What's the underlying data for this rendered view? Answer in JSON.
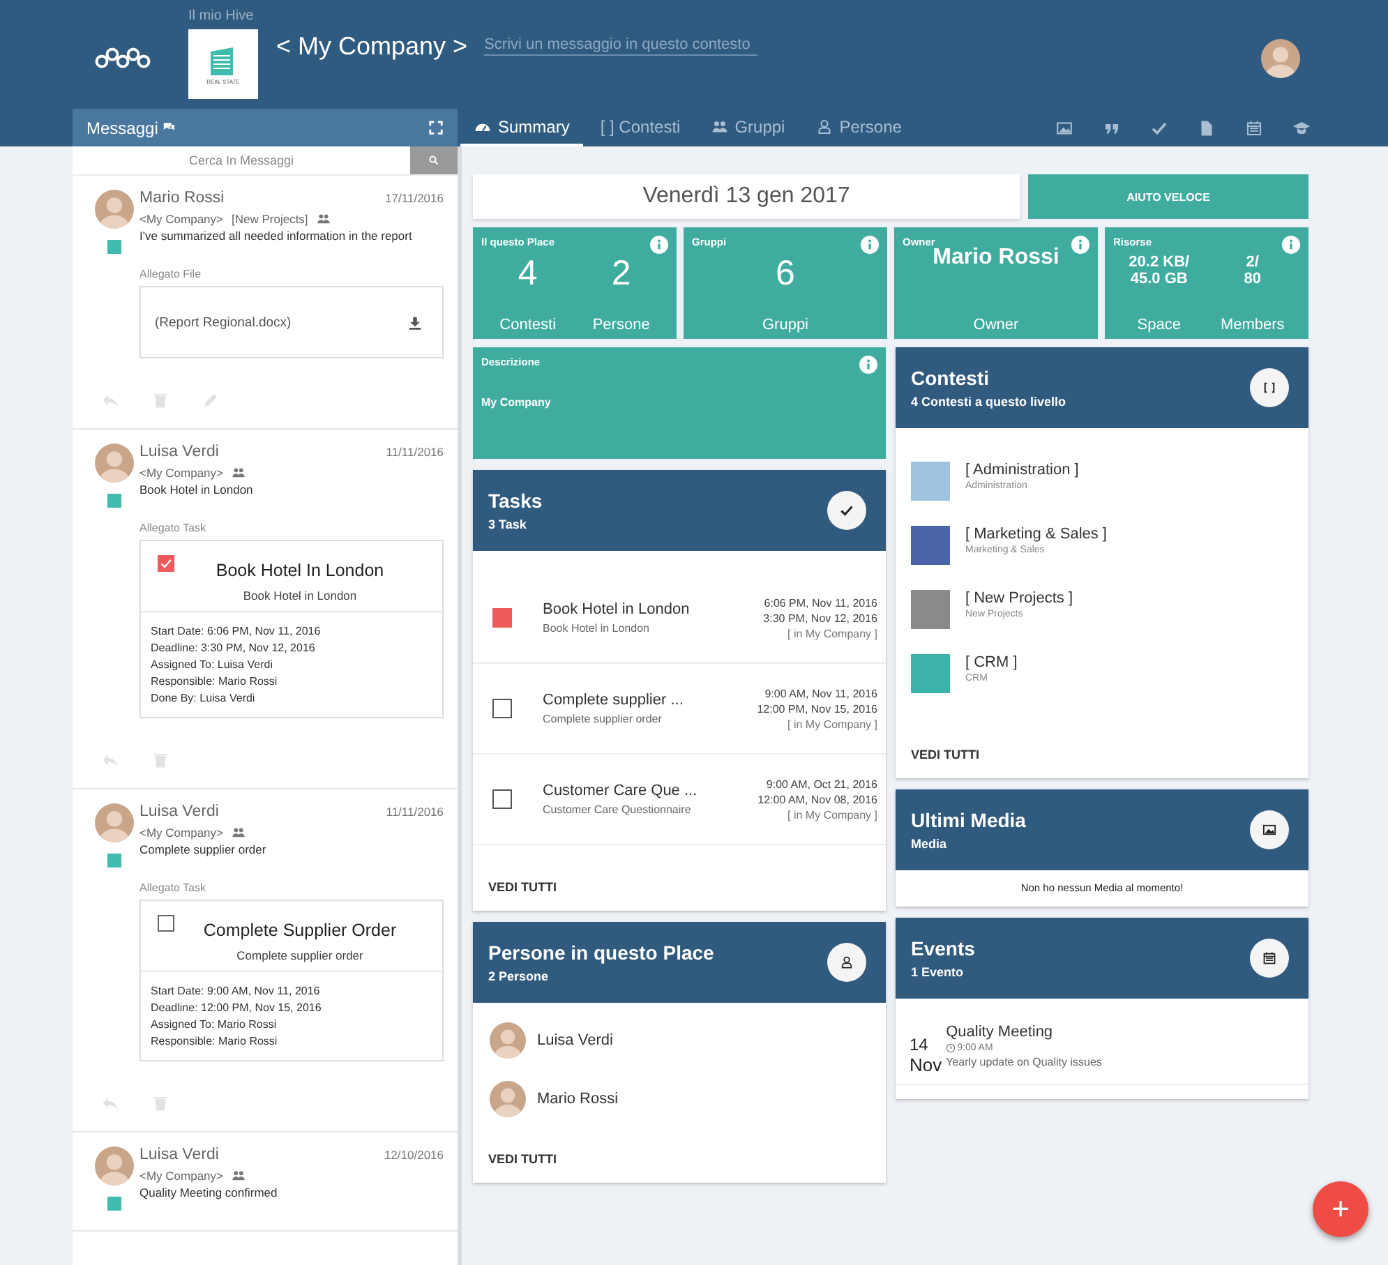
{
  "header": {
    "supertitle": "Il mio Hive",
    "logo_caption": "REAL STATE",
    "title": "< My Company >",
    "message_placeholder": "Scrivi un messaggio in questo contesto"
  },
  "messages_panel": {
    "title": "Messaggi",
    "search_placeholder": "Cerca In Messaggi",
    "messages": [
      {
        "author": "Mario Rossi",
        "date": "17/11/2016",
        "context": "<My Company>",
        "project": "[New Projects]",
        "text": "I've summarized all needed information in the report",
        "attachment_label": "Allegato File",
        "attachment": {
          "kind": "file",
          "name": "(Report Regional.docx)"
        },
        "editable": true
      },
      {
        "author": "Luisa Verdi",
        "date": "11/11/2016",
        "context": "<My Company>",
        "text": "Book Hotel in London",
        "attachment_label": "Allegato Task",
        "attachment": {
          "kind": "task",
          "checked": true,
          "title": "Book Hotel In London",
          "subtitle": "Book Hotel in London",
          "details": [
            "Start Date: 6:06 PM, Nov 11, 2016",
            "Deadline: 3:30 PM, Nov 12, 2016",
            "Assigned To: Luisa Verdi",
            "Responsible: Mario Rossi",
            "Done By: Luisa Verdi"
          ]
        },
        "editable": false
      },
      {
        "author": "Luisa Verdi",
        "date": "11/11/2016",
        "context": "<My Company>",
        "text": "Complete supplier order",
        "attachment_label": "Allegato Task",
        "attachment": {
          "kind": "task",
          "checked": false,
          "title": "Complete Supplier Order",
          "subtitle": "Complete supplier order",
          "details": [
            "Start Date: 9:00 AM, Nov 11, 2016",
            "Deadline: 12:00 PM, Nov 15, 2016",
            "Assigned To: Mario Rossi",
            "Responsible: Mario Rossi"
          ]
        },
        "editable": false
      },
      {
        "author": "Luisa Verdi",
        "date": "12/10/2016",
        "context": "<My Company>",
        "text": "Quality Meeting confirmed"
      }
    ]
  },
  "tabs": [
    {
      "label": "Summary",
      "selected": true
    },
    {
      "label": "[ ] Contesti",
      "selected": false
    },
    {
      "label": "Gruppi",
      "selected": false
    },
    {
      "label": "Persone",
      "selected": false
    }
  ],
  "date_bar": {
    "date": "Venerdì 13 gen 2017",
    "button": "AIUTO VELOCE"
  },
  "stats": [
    {
      "title": "Il questo Place",
      "kind": "big",
      "items": [
        {
          "value": "4",
          "label": "Contesti"
        },
        {
          "value": "2",
          "label": "Persone"
        }
      ]
    },
    {
      "title": "Gruppi",
      "kind": "big",
      "items": [
        {
          "value": "6",
          "label": "Gruppi"
        }
      ]
    },
    {
      "title": "Owner",
      "kind": "name",
      "items": [
        {
          "value": "Mario Rossi",
          "label": "Owner"
        }
      ]
    },
    {
      "title": "Risorse",
      "kind": "small",
      "items": [
        {
          "value": "20.2 KB/\n45.0 GB",
          "label": "Space"
        },
        {
          "value": "2/\n80",
          "label": "Members"
        }
      ]
    }
  ],
  "description": {
    "title": "Descrizione",
    "text": "My Company"
  },
  "tasks": {
    "title": "Tasks",
    "subtitle": "3 Task",
    "footer": "VEDI TUTTI",
    "items": [
      {
        "checked": true,
        "title": "Book Hotel in London",
        "subtitle": "Book Hotel in London",
        "start": "6:06 PM, Nov 11, 2016",
        "deadline": "3:30 PM, Nov 12, 2016",
        "context": "[ in My Company ]"
      },
      {
        "checked": false,
        "title": "Complete supplier ...",
        "subtitle": "Complete supplier order",
        "start": "9:00 AM, Nov 11, 2016",
        "deadline": "12:00 PM, Nov 15, 2016",
        "context": "[ in My Company ]"
      },
      {
        "checked": false,
        "title": "Customer Care Que ...",
        "subtitle": "Customer Care Questionnaire",
        "start": "9:00 AM, Oct 21, 2016",
        "deadline": "12:00 AM, Nov 08, 2016",
        "context": "[ in My Company ]"
      }
    ]
  },
  "people": {
    "title": "Persone in questo Place",
    "subtitle": "2 Persone",
    "footer": "VEDI TUTTI",
    "items": [
      {
        "name": "Luisa Verdi"
      },
      {
        "name": "Mario Rossi"
      }
    ]
  },
  "contexts": {
    "title": "Contesti",
    "subtitle": "4 Contesti a questo livello",
    "footer": "VEDI TUTTI",
    "items": [
      {
        "title": "[ Administration ]",
        "subtitle": "Administration",
        "color": "#9fc3de"
      },
      {
        "title": "[ Marketing & Sales ]",
        "subtitle": "Marketing & Sales",
        "color": "#4a64a8"
      },
      {
        "title": "[ New Projects ]",
        "subtitle": "New Projects",
        "color": "#8a8a8a"
      },
      {
        "title": "[ CRM ]",
        "subtitle": "CRM",
        "color": "#3bb3a8"
      }
    ]
  },
  "media": {
    "title": "Ultimi Media",
    "subtitle": "Media",
    "empty_text": "Non ho nessun Media al momento!"
  },
  "events": {
    "title": "Events",
    "subtitle": "1 Evento",
    "items": [
      {
        "day": "14",
        "month": "Nov",
        "title": "Quality Meeting",
        "time": "9:00 AM",
        "description": "Yearly update on Quality issues"
      }
    ]
  },
  "fab": "+"
}
